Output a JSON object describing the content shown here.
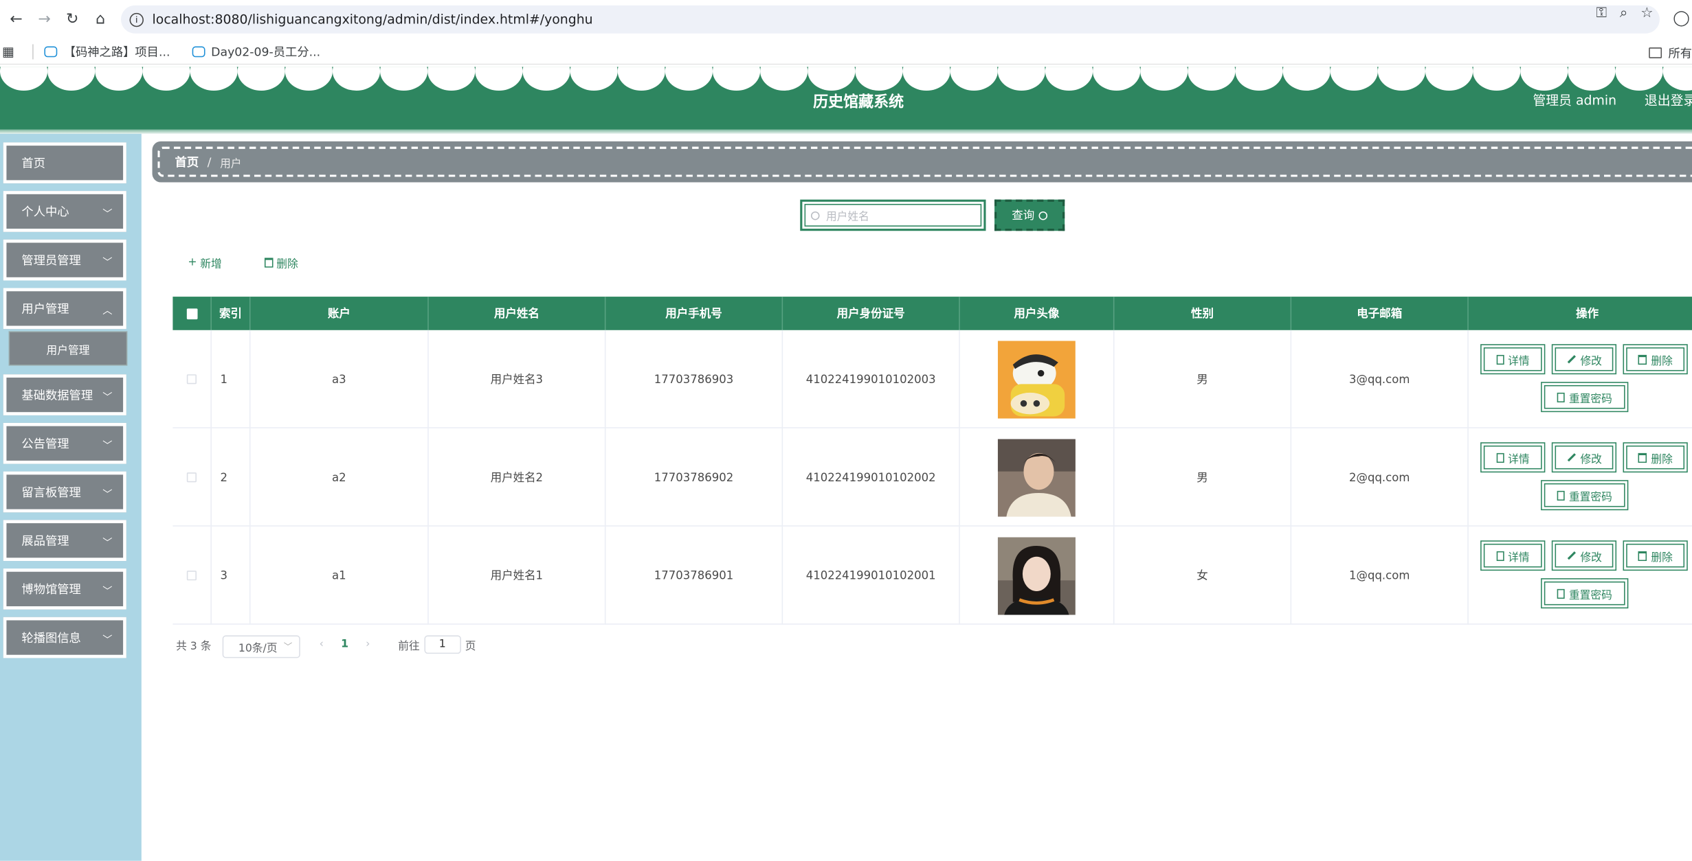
{
  "browser": {
    "url": "localhost:8080/lishiguancangxitong/admin/dist/index.html#/yonghu",
    "bookmarks": [
      "【码神之路】项目...",
      "Day02-09-员工分..."
    ],
    "bookmarks_right": "所有"
  },
  "header": {
    "title": "历史馆藏系统",
    "user": "管理员 admin",
    "logout": "退出登录"
  },
  "sidebar": {
    "items": [
      {
        "label": "首页"
      },
      {
        "label": "个人中心"
      },
      {
        "label": "管理员管理"
      },
      {
        "label": "用户管理"
      },
      {
        "label": "基础数据管理"
      },
      {
        "label": "公告管理"
      },
      {
        "label": "留言板管理"
      },
      {
        "label": "展品管理"
      },
      {
        "label": "博物馆管理"
      },
      {
        "label": "轮播图信息"
      }
    ],
    "submenu": "用户管理"
  },
  "breadcrumb": {
    "home": "首页",
    "current": "用户"
  },
  "search": {
    "placeholder": "用户姓名",
    "button": "查询"
  },
  "actions": {
    "add": "新增",
    "delete": "删除"
  },
  "table": {
    "headers": [
      "索引",
      "账户",
      "用户姓名",
      "用户手机号",
      "用户身份证号",
      "用户头像",
      "性别",
      "电子邮箱",
      "操作"
    ],
    "rows": [
      {
        "index": "1",
        "account": "a3",
        "name": "用户姓名3",
        "phone": "17703786903",
        "id_card": "410224199010102003",
        "gender": "男",
        "email": "3@qq.com"
      },
      {
        "index": "2",
        "account": "a2",
        "name": "用户姓名2",
        "phone": "17703786902",
        "id_card": "410224199010102002",
        "gender": "男",
        "email": "2@qq.com"
      },
      {
        "index": "3",
        "account": "a1",
        "name": "用户姓名1",
        "phone": "17703786901",
        "id_card": "410224199010102001",
        "gender": "女",
        "email": "1@qq.com"
      }
    ],
    "ops": {
      "detail": "详情",
      "edit": "修改",
      "delete": "删除",
      "reset": "重置密码"
    }
  },
  "pagination": {
    "total": "共 3 条",
    "page_size": "10条/页",
    "current": "1",
    "goto_prefix": "前往",
    "goto_value": "1",
    "goto_suffix": "页"
  },
  "colors": {
    "primary": "#2e8660",
    "sidebar": "#acd6e5",
    "menu_item": "#7d8489"
  }
}
